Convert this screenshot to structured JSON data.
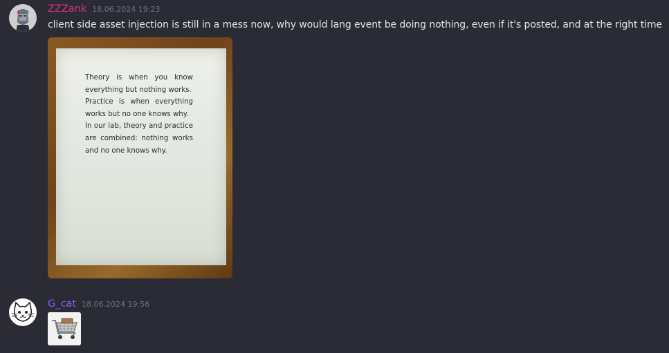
{
  "messages": [
    {
      "username": "ZZZank",
      "username_color": "#d6337a",
      "timestamp": "18.06.2024 19:23",
      "text": "client side  asset injection is still in a mess now, why would lang event be doing nothing, even if it's posted, and at the right time",
      "attachment": {
        "kind": "photo",
        "note_paragraphs": [
          "Theory is when you know everything but nothing works.",
          "Practice is when everything works but no one knows why.",
          "In our lab, theory and practice are combined: nothing works and no one knows why."
        ]
      }
    },
    {
      "username": "G_cat",
      "username_color": "#8a5cf0",
      "timestamp": "18.06.2024 19:56",
      "attachment": {
        "kind": "image-thumbnail",
        "icon": "shopping-cart-icon"
      }
    }
  ]
}
